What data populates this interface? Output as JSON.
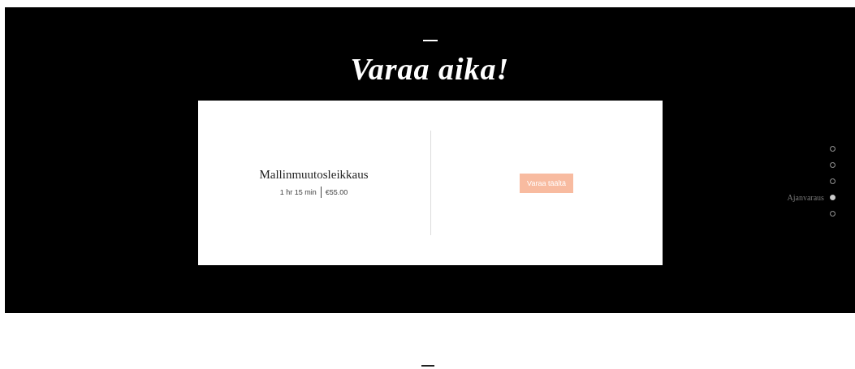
{
  "header": {
    "title": "Varaa aika!"
  },
  "service": {
    "name": "Mallinmuutosleikkaus",
    "duration": "1 hr 15 min",
    "price": "€55.00",
    "button": "Varaa täältä"
  },
  "nav_dots": [
    {
      "selected": false
    },
    {
      "selected": false
    },
    {
      "selected": false
    },
    {
      "label": "Ajanvaraus",
      "selected": true
    },
    {
      "selected": false
    }
  ]
}
